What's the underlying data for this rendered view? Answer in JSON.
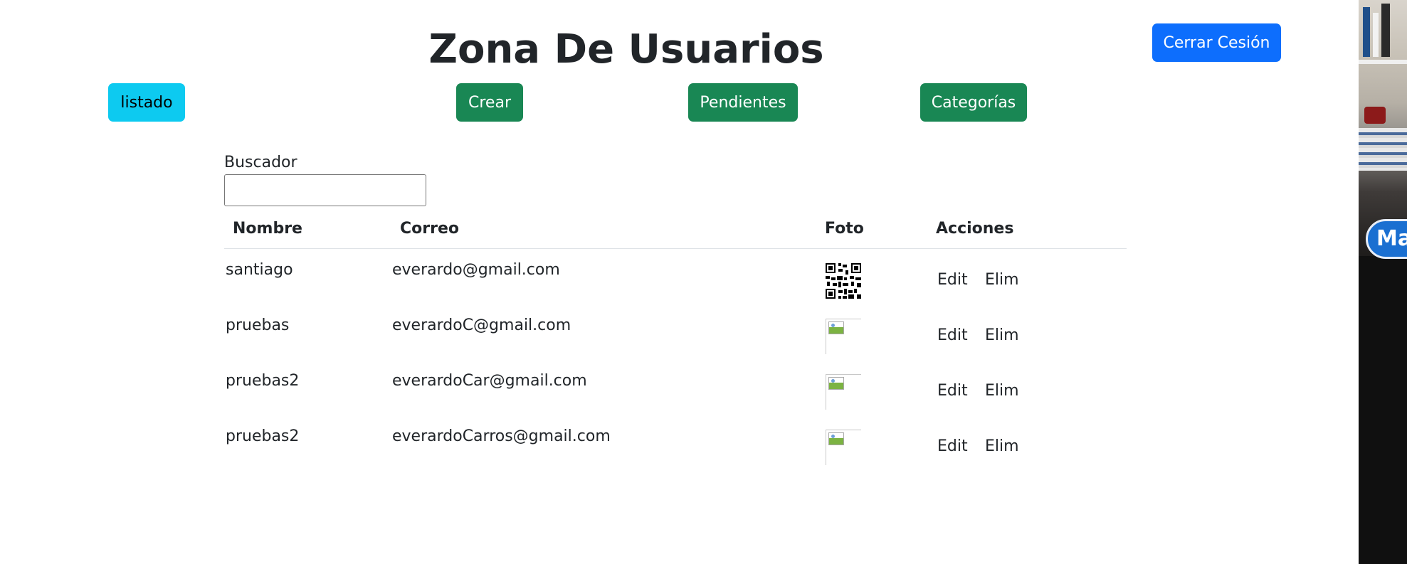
{
  "header": {
    "title": "Zona De Usuarios",
    "logout_label": "Cerrar Cesión"
  },
  "nav": {
    "listado": "listado",
    "crear": "Crear",
    "pendientes": "Pendientes",
    "categorias": "Categorías"
  },
  "search": {
    "label": "Buscador",
    "value": "",
    "placeholder": ""
  },
  "table": {
    "headers": {
      "nombre": "Nombre",
      "correo": "Correo",
      "foto": "Foto",
      "acciones": "Acciones"
    },
    "rows": [
      {
        "nombre": "santiago",
        "correo": "everardo@gmail.com",
        "foto": "qr-code-image",
        "edit": "Edit",
        "elim": "Elim"
      },
      {
        "nombre": "pruebas",
        "correo": "everardoC@gmail.com",
        "foto": "broken-image-icon",
        "edit": "Edit",
        "elim": "Elim"
      },
      {
        "nombre": "pruebas2",
        "correo": "everardoCar@gmail.com",
        "foto": "broken-image-icon",
        "edit": "Edit",
        "elim": "Elim"
      },
      {
        "nombre": "pruebas2",
        "correo": "everardoCarros@gmail.com",
        "foto": "broken-image-icon",
        "edit": "Edit",
        "elim": "Elim"
      }
    ]
  },
  "overlay": {
    "badge_text": "Ma"
  },
  "colors": {
    "primary": "#0d6efd",
    "info": "#0dcaf0",
    "success": "#198754",
    "text": "#212529"
  }
}
